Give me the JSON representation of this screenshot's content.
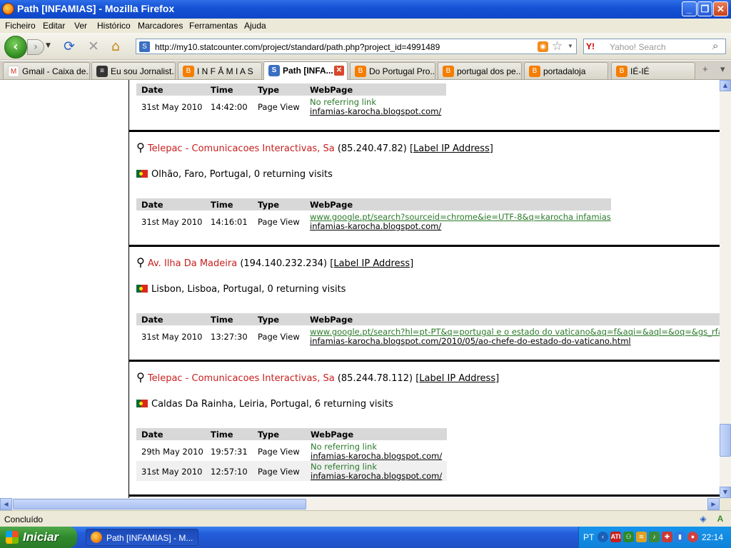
{
  "window": {
    "title": "Path [INFAMIAS] - Mozilla Firefox",
    "min": "_",
    "max": "❐",
    "close": "✕"
  },
  "menu": [
    "Ficheiro",
    "Editar",
    "Ver",
    "Histórico",
    "Marcadores",
    "Ferramentas",
    "Ajuda"
  ],
  "nav": {
    "back_glyph": "‹",
    "fwd_glyph": "›",
    "reload_glyph": "⟳",
    "stop_glyph": "✕",
    "home_glyph": "⌂",
    "url": "http://my10.statcounter.com/project/standard/path.php?project_id=4991489",
    "search_placeholder": "Yahoo! Search",
    "search_engine": "Y!"
  },
  "tabs": [
    {
      "label": "Gmail - Caixa de...",
      "icon": "gmail-icon",
      "icon_text": "M",
      "color": "#ffffff",
      "text_color": "#d93025"
    },
    {
      "label": "Eu sou Jornalist...",
      "icon": "site-icon",
      "icon_text": "≡",
      "color": "#333333",
      "text_color": "#ffffff"
    },
    {
      "label": "I N F Â M I A S",
      "icon": "blogger-icon",
      "icon_text": "B",
      "color": "#f57d00",
      "text_color": "#ffffff"
    },
    {
      "label": "Path [INFA...",
      "icon": "statcounter-icon",
      "icon_text": "S",
      "color": "#3a6fc2",
      "text_color": "#ffffff",
      "active": true
    },
    {
      "label": "Do Portugal Pro...",
      "icon": "blogger-icon",
      "icon_text": "B",
      "color": "#f57d00",
      "text_color": "#ffffff"
    },
    {
      "label": "portugal dos pe...",
      "icon": "blogger-icon",
      "icon_text": "B",
      "color": "#f57d00",
      "text_color": "#ffffff"
    },
    {
      "label": "portadaloja",
      "icon": "blogger-icon",
      "icon_text": "B",
      "color": "#f57d00",
      "text_color": "#ffffff"
    },
    {
      "label": "IÉ-IÉ",
      "icon": "blogger-icon",
      "icon_text": "B",
      "color": "#f57d00",
      "text_color": "#ffffff"
    }
  ],
  "tab_controls": {
    "new": "+",
    "list": "▾"
  },
  "table_headers": {
    "date": "Date",
    "time": "Time",
    "type": "Type",
    "webpage": "WebPage"
  },
  "first_block": {
    "rows": [
      {
        "date": "31st May 2010",
        "time": "14:42:00",
        "type": "Page View",
        "ref": "No referring link",
        "ref_is_link": false,
        "page": "infamias-karocha.blogspot.com/"
      }
    ]
  },
  "visits": [
    {
      "isp": "Telepac - Comunicacoes Interactivas, Sa",
      "ip": "(85.240.47.82)",
      "label": "[Label IP Address]",
      "location": "Olhão, Faro, Portugal, 0 returning visits",
      "rows": [
        {
          "date": "31st May 2010",
          "time": "14:16:01",
          "type": "Page View",
          "ref": "www.google.pt/search?sourceid=chrome&ie=UTF-8&q=karocha infamias",
          "ref_is_link": true,
          "page": "infamias-karocha.blogspot.com/"
        }
      ]
    },
    {
      "isp": "Av. Ilha Da Madeira",
      "ip": "(194.140.232.234)",
      "label": "[Label IP Address]",
      "location": "Lisbon, Lisboa, Portugal, 0 returning visits",
      "rows": [
        {
          "date": "31st May 2010",
          "time": "13:27:30",
          "type": "Page View",
          "ref": "www.google.pt/search?hl=pt-PT&q=portugal e o estado do vaticano&aq=f&aqi=&aql=&oq=&gs_rfai=",
          "ref_is_link": true,
          "page": "infamias-karocha.blogspot.com/2010/05/ao-chefe-do-estado-do-vaticano.html"
        }
      ]
    },
    {
      "isp": "Telepac - Comunicacoes Interactivas, Sa",
      "ip": "(85.244.78.112)",
      "label": "[Label IP Address]",
      "location": "Caldas Da Rainha, Leiria, Portugal, 6 returning visits",
      "rows": [
        {
          "date": "29th May 2010",
          "time": "19:57:31",
          "type": "Page View",
          "ref": "No referring link",
          "ref_is_link": false,
          "page": "infamias-karocha.blogspot.com/"
        },
        {
          "date": "31st May 2010",
          "time": "12:57:10",
          "type": "Page View",
          "ref": "No referring link",
          "ref_is_link": false,
          "page": "infamias-karocha.blogspot.com/"
        }
      ]
    }
  ],
  "status": {
    "text": "Concluído"
  },
  "taskbar": {
    "start": "Iniciar",
    "item": "Path [INFAMIAS] - M...",
    "lang": "PT",
    "clock": "22:14",
    "tray_ati": "ATI"
  }
}
